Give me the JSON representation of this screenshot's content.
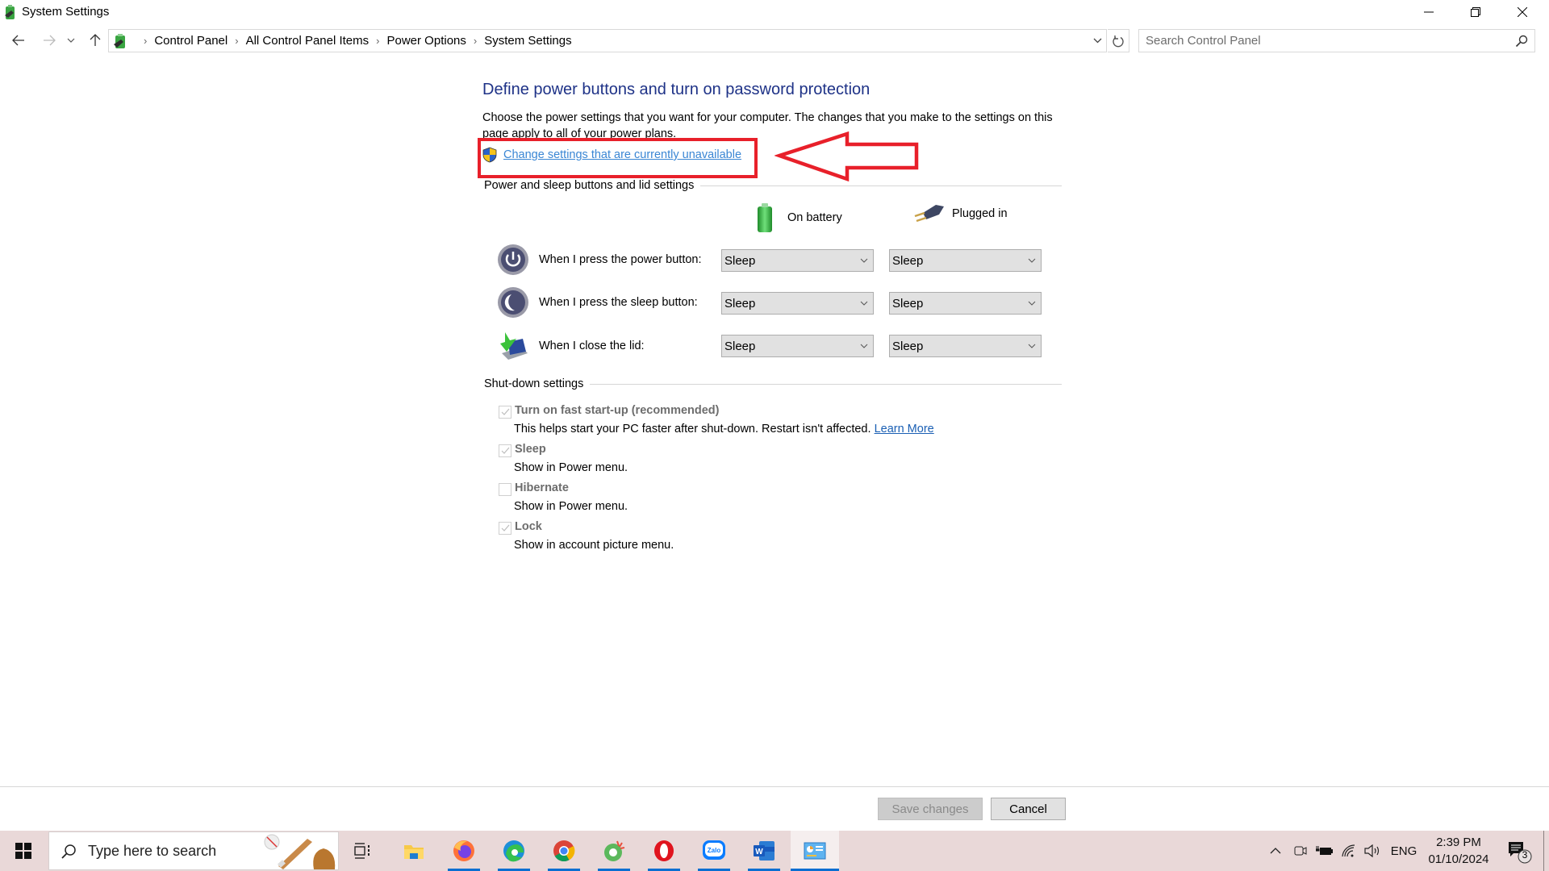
{
  "window": {
    "title": "System Settings",
    "controls": {
      "minimize": "minimize",
      "maximize": "restore",
      "close": "close"
    }
  },
  "nav": {
    "back_icon": "arrow-left-icon",
    "forward_icon": "arrow-right-icon",
    "recent_icon": "chevron-down-icon",
    "up_icon": "arrow-up-icon",
    "breadcrumb": [
      "Control Panel",
      "All Control Panel Items",
      "Power Options",
      "System Settings"
    ],
    "search_placeholder": "Search Control Panel",
    "search_value": ""
  },
  "content": {
    "title": "Define power buttons and turn on password protection",
    "intro": "Choose the power settings that you want for your computer. The changes that you make to the settings on this page apply to all of your power plans.",
    "uac_link": "Change settings that are currently unavailable",
    "annotation": {
      "color": "#e8202a",
      "shape": "box-and-left-arrow"
    },
    "power_group_label": "Power and sleep buttons and lid settings",
    "columns": [
      "On battery",
      "Plugged in"
    ],
    "rows": [
      {
        "label": "When I press the power button:",
        "icon": "power-button-icon",
        "on_battery": "Sleep",
        "plugged_in": "Sleep"
      },
      {
        "label": "When I press the sleep button:",
        "icon": "sleep-button-icon",
        "on_battery": "Sleep",
        "plugged_in": "Sleep"
      },
      {
        "label": "When I close the lid:",
        "icon": "laptop-lid-icon",
        "on_battery": "Sleep",
        "plugged_in": "Sleep"
      }
    ],
    "shutdown_group_label": "Shut-down settings",
    "shutdown": [
      {
        "label": "Turn on fast start-up (recommended)",
        "desc": "This helps start your PC faster after shut-down. Restart isn't affected.",
        "link": "Learn More",
        "checked": true,
        "disabled": true
      },
      {
        "label": "Sleep",
        "desc": "Show in Power menu.",
        "checked": true,
        "disabled": true
      },
      {
        "label": "Hibernate",
        "desc": "Show in Power menu.",
        "checked": false,
        "disabled": true
      },
      {
        "label": "Lock",
        "desc": "Show in account picture menu.",
        "checked": true,
        "disabled": true
      }
    ]
  },
  "footer": {
    "save_label": "Save changes",
    "cancel_label": "Cancel"
  },
  "taskbar": {
    "search_placeholder": "Type here to search",
    "apps": [
      "File Explorer",
      "Firefox",
      "Microsoft Edge",
      "Google Chrome",
      "Coc Coc",
      "Opera",
      "Zalo",
      "Microsoft Word",
      "Control Panel"
    ],
    "tray": {
      "language": "ENG",
      "time": "2:39 PM",
      "date": "01/10/2024",
      "notification_count": "3"
    }
  }
}
